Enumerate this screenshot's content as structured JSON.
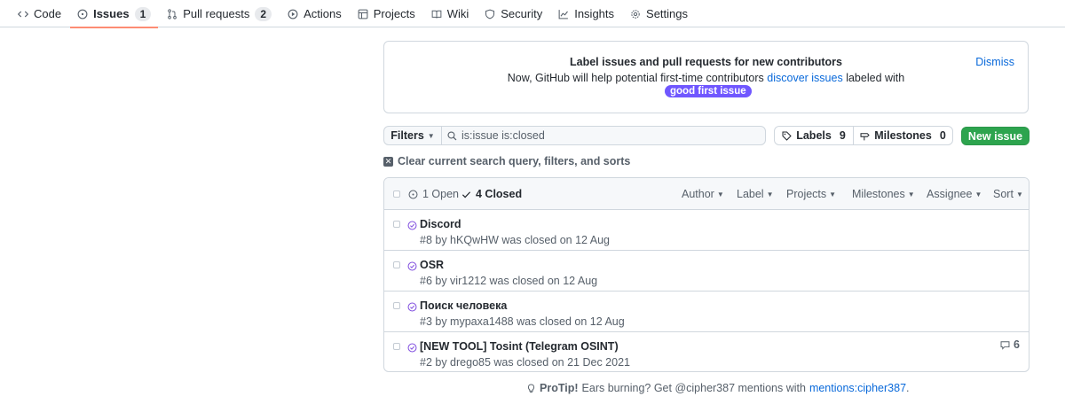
{
  "nav": {
    "items": [
      {
        "label": "Code",
        "icon": "code-icon"
      },
      {
        "label": "Issues",
        "icon": "issue-opened-icon",
        "count": "1",
        "active": true
      },
      {
        "label": "Pull requests",
        "icon": "git-pull-request-icon",
        "count": "2"
      },
      {
        "label": "Actions",
        "icon": "play-icon"
      },
      {
        "label": "Projects",
        "icon": "table-icon"
      },
      {
        "label": "Wiki",
        "icon": "book-icon"
      },
      {
        "label": "Security",
        "icon": "shield-icon"
      },
      {
        "label": "Insights",
        "icon": "graph-icon"
      },
      {
        "label": "Settings",
        "icon": "gear-icon"
      }
    ]
  },
  "banner": {
    "title": "Label issues and pull requests for new contributors",
    "text_before": "Now, GitHub will help potential first-time contributors",
    "link": "discover issues",
    "text_after": "labeled with",
    "label": "good first issue",
    "label_color": "#7057ff",
    "dismiss": "Dismiss"
  },
  "filterbar": {
    "filters_label": "Filters",
    "search_value": "is:issue is:closed",
    "labels_label": "Labels",
    "labels_count": "9",
    "milestones_label": "Milestones",
    "milestones_count": "0",
    "new_issue_label": "New issue",
    "clear_label": "Clear current search query, filters, and sorts"
  },
  "list_header": {
    "open_label": "1 Open",
    "closed_label": "4 Closed",
    "filters": [
      "Author",
      "Label",
      "Projects",
      "Milestones",
      "Assignee",
      "Sort"
    ]
  },
  "issues": [
    {
      "title": "Discord",
      "meta": "#8 by hKQwHW was closed on 12 Aug",
      "comments": ""
    },
    {
      "title": "OSR",
      "meta": "#6 by vir1212 was closed on 12 Aug",
      "comments": ""
    },
    {
      "title": "Поиск человека",
      "meta": "#3 by mypaxa1488 was closed on 12 Aug",
      "comments": ""
    },
    {
      "title": "[NEW TOOL] Tosint (Telegram OSINT)",
      "meta": "#2 by drego85 was closed on 21 Dec 2021",
      "comments": "6"
    }
  ],
  "protip": {
    "prefix": "ProTip!",
    "text": "Ears burning? Get @cipher387 mentions with",
    "link": "mentions:cipher387",
    "suffix": "."
  },
  "colors": {
    "accent_link": "#0969da",
    "closed_purple": "#8250df",
    "primary_green": "#2da44e",
    "active_tab_underline": "#fd8c73"
  }
}
